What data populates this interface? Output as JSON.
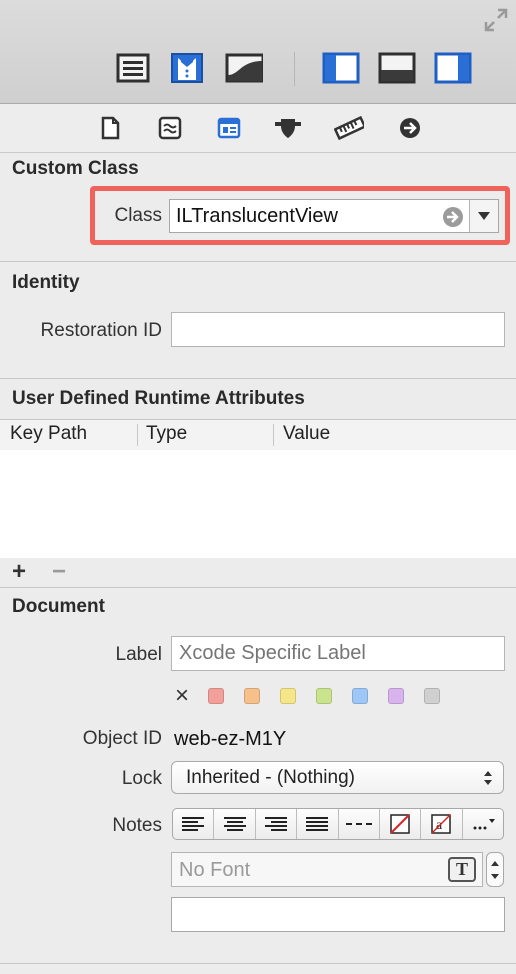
{
  "toolbar": {
    "buttons": [
      "list-view-icon",
      "tuxedo-icon",
      "curve-icon"
    ],
    "layout_buttons": [
      "left-panel-icon",
      "bottom-panel-icon",
      "right-panel-icon"
    ],
    "accent": "#2a6fd6"
  },
  "inspector_tabs": [
    "file-inspector",
    "quick-help",
    "identity-inspector",
    "attributes-inspector",
    "size-inspector",
    "connections-inspector"
  ],
  "custom_class": {
    "title": "Custom Class",
    "class_label": "Class",
    "class_value": "ILTranslucentView"
  },
  "identity": {
    "title": "Identity",
    "restoration_label": "Restoration ID",
    "restoration_value": ""
  },
  "udra": {
    "title": "User Defined Runtime Attributes",
    "columns": [
      "Key Path",
      "Type",
      "Value"
    ],
    "add_label": "+",
    "remove_label": "−"
  },
  "document": {
    "title": "Document",
    "label_label": "Label",
    "label_placeholder": "Xcode Specific Label",
    "clear_color_label": "×",
    "colors": [
      "#f4a09a",
      "#f7c08a",
      "#f7e58a",
      "#c9e48c",
      "#9cc7f7",
      "#d9b3ee",
      "#d0d0d0"
    ],
    "object_id_label": "Object ID",
    "object_id_value": "web-ez-M1Y",
    "lock_label": "Lock",
    "lock_value": "Inherited - (Nothing)",
    "notes_label": "Notes",
    "font_placeholder": "No Font",
    "font_button_label": "T",
    "notes_value": ""
  },
  "highlight_color": "#f0635a"
}
